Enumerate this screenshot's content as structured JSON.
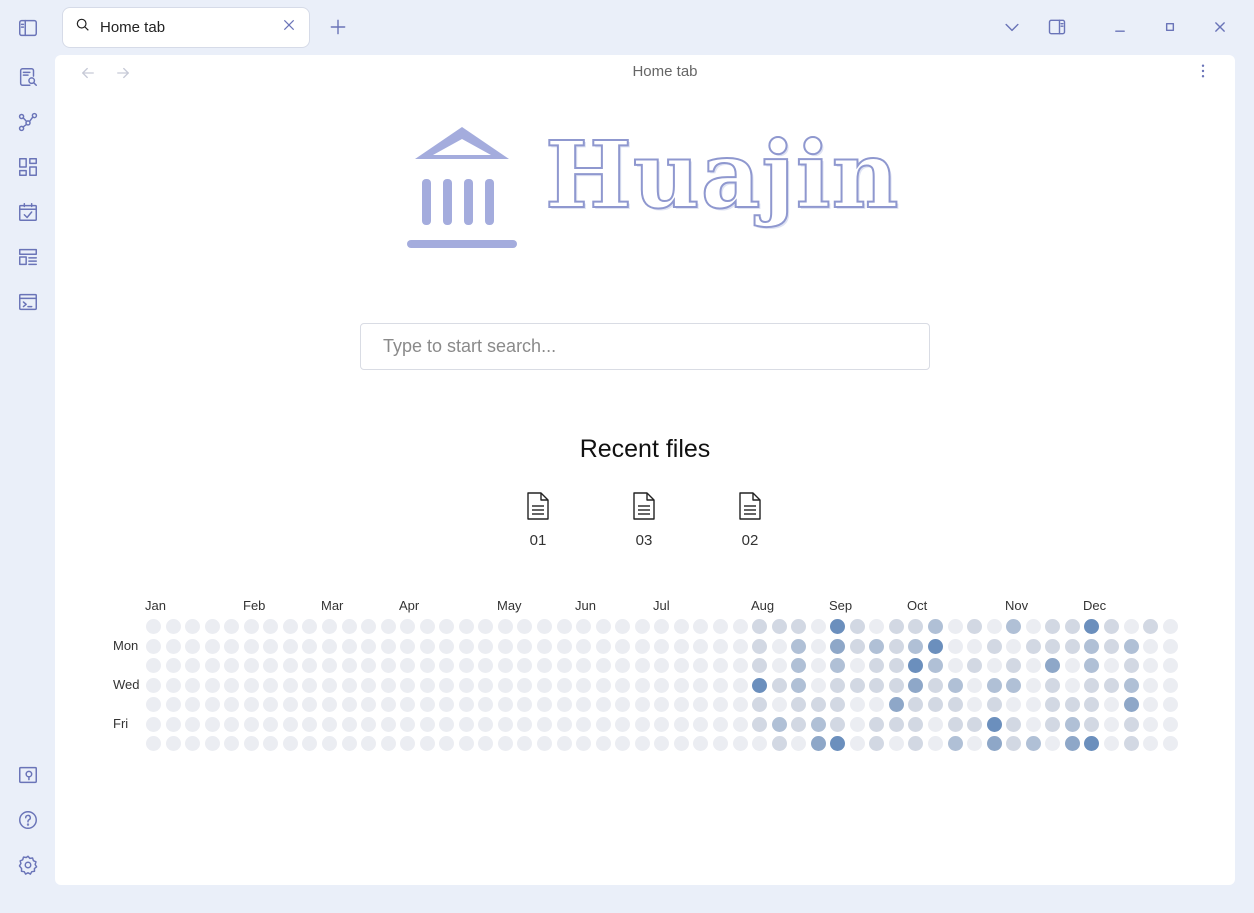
{
  "tab": {
    "title": "Home tab"
  },
  "view": {
    "title": "Home tab"
  },
  "brand": {
    "name": "Huajin"
  },
  "search": {
    "placeholder": "Type to start search..."
  },
  "recent": {
    "title": "Recent files",
    "files": [
      "01",
      "03",
      "02"
    ]
  },
  "ribbon": {
    "top_icons": [
      "sidebar-toggle-icon",
      "search-notes-icon",
      "graph-view-icon",
      "dashboard-icon",
      "calendar-check-icon",
      "layout-list-icon",
      "terminal-icon"
    ],
    "bottom_icons": [
      "vault-icon",
      "help-icon",
      "settings-icon"
    ]
  },
  "colors": {
    "accent": "#6a74b8",
    "brand": "#a4acdd",
    "heat_levels": [
      "#ebedf2",
      "#d2d8e3",
      "#b0c0d6",
      "#8ea7c8",
      "#6b8fbd"
    ]
  },
  "heatmap": {
    "months": [
      "Jan",
      "Feb",
      "Mar",
      "Apr",
      "May",
      "Jun",
      "Jul",
      "Aug",
      "Sep",
      "Oct",
      "Nov",
      "Dec"
    ],
    "days": [
      "Mon",
      "Wed",
      "Fri"
    ],
    "weeks": 53,
    "active_levels": [
      [
        0,
        0,
        0,
        0,
        0,
        0,
        0
      ],
      [
        0,
        0,
        0,
        0,
        0,
        0,
        0
      ],
      [
        0,
        0,
        0,
        0,
        0,
        0,
        0
      ],
      [
        0,
        0,
        0,
        0,
        0,
        0,
        0
      ],
      [
        0,
        0,
        0,
        0,
        0,
        0,
        0
      ],
      [
        0,
        0,
        0,
        0,
        0,
        0,
        0
      ],
      [
        0,
        0,
        0,
        0,
        0,
        0,
        0
      ],
      [
        0,
        0,
        0,
        0,
        0,
        0,
        0
      ],
      [
        0,
        0,
        0,
        0,
        0,
        0,
        0
      ],
      [
        0,
        0,
        0,
        0,
        0,
        0,
        0
      ],
      [
        0,
        0,
        0,
        0,
        0,
        0,
        0
      ],
      [
        0,
        0,
        0,
        0,
        0,
        0,
        0
      ],
      [
        0,
        0,
        0,
        0,
        0,
        0,
        0
      ],
      [
        0,
        0,
        0,
        0,
        0,
        0,
        0
      ],
      [
        0,
        0,
        0,
        0,
        0,
        0,
        0
      ],
      [
        0,
        0,
        0,
        0,
        0,
        0,
        0
      ],
      [
        0,
        0,
        0,
        0,
        0,
        0,
        0
      ],
      [
        0,
        0,
        0,
        0,
        0,
        0,
        0
      ],
      [
        0,
        0,
        0,
        0,
        0,
        0,
        0
      ],
      [
        0,
        0,
        0,
        0,
        0,
        0,
        0
      ],
      [
        0,
        0,
        0,
        0,
        0,
        0,
        0
      ],
      [
        0,
        0,
        0,
        0,
        0,
        0,
        0
      ],
      [
        0,
        0,
        0,
        0,
        0,
        0,
        0
      ],
      [
        0,
        0,
        0,
        0,
        0,
        0,
        0
      ],
      [
        0,
        0,
        0,
        0,
        0,
        0,
        0
      ],
      [
        0,
        0,
        0,
        0,
        0,
        0,
        0
      ],
      [
        0,
        0,
        0,
        0,
        0,
        0,
        0
      ],
      [
        0,
        0,
        0,
        0,
        0,
        0,
        0
      ],
      [
        0,
        0,
        0,
        0,
        0,
        0,
        0
      ],
      [
        0,
        0,
        0,
        0,
        0,
        0,
        0
      ],
      [
        0,
        0,
        0,
        0,
        0,
        0,
        0
      ],
      [
        1,
        1,
        1,
        4,
        1,
        1,
        0
      ],
      [
        1,
        0,
        0,
        1,
        0,
        2,
        1
      ],
      [
        1,
        2,
        2,
        2,
        1,
        1,
        0
      ],
      [
        0,
        0,
        0,
        0,
        1,
        2,
        3
      ],
      [
        4,
        3,
        2,
        1,
        1,
        1,
        4
      ],
      [
        1,
        1,
        0,
        1,
        0,
        0,
        0
      ],
      [
        0,
        2,
        1,
        1,
        0,
        1,
        1
      ],
      [
        1,
        1,
        1,
        1,
        3,
        1,
        0
      ],
      [
        1,
        2,
        4,
        3,
        1,
        1,
        1
      ],
      [
        2,
        4,
        2,
        1,
        1,
        0,
        0
      ],
      [
        0,
        0,
        0,
        2,
        1,
        1,
        2
      ],
      [
        1,
        0,
        1,
        0,
        0,
        1,
        0
      ],
      [
        0,
        1,
        0,
        2,
        1,
        4,
        3
      ],
      [
        2,
        0,
        1,
        2,
        0,
        1,
        1
      ],
      [
        0,
        1,
        0,
        0,
        0,
        0,
        2
      ],
      [
        1,
        1,
        3,
        1,
        1,
        1,
        0
      ],
      [
        1,
        1,
        0,
        0,
        1,
        2,
        3
      ],
      [
        4,
        2,
        2,
        1,
        1,
        1,
        4
      ],
      [
        1,
        1,
        0,
        1,
        0,
        0,
        0
      ],
      [
        0,
        2,
        1,
        2,
        3,
        1,
        1
      ],
      [
        1,
        0,
        0,
        0,
        0,
        0,
        0
      ],
      [
        0,
        0,
        0,
        0,
        0,
        0,
        0
      ]
    ]
  }
}
